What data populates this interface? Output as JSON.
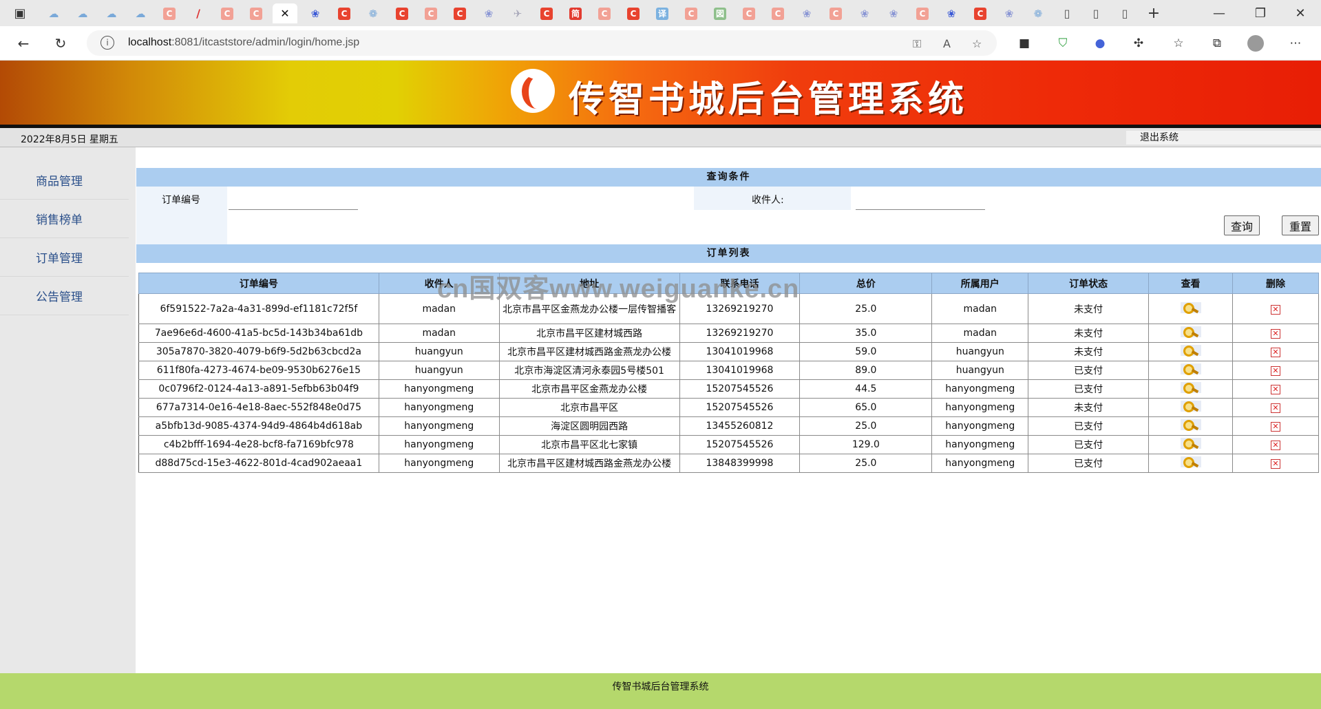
{
  "browser": {
    "url_host": "localhost",
    "url_path": ":8081/itcaststore/admin/login/home.jsp"
  },
  "banner": {
    "title": "传智书城后台管理系统"
  },
  "infobar": {
    "date": "2022年8月5日 星期五",
    "logout": "退出系统"
  },
  "sidebar": {
    "items": [
      {
        "label": "商品管理"
      },
      {
        "label": "销售榜单"
      },
      {
        "label": "订单管理"
      },
      {
        "label": "公告管理"
      }
    ]
  },
  "query": {
    "heading": "查询条件",
    "order_id_label": "订单编号",
    "receiver_label": "收件人:",
    "search_button": "查询",
    "reset_button": "重置"
  },
  "orders": {
    "heading": "订单列表",
    "columns": [
      "订单编号",
      "收件人",
      "地址",
      "联系电话",
      "总价",
      "所属用户",
      "订单状态",
      "查看",
      "删除"
    ],
    "rows": [
      {
        "id": "6f591522-7a2a-4a31-899d-ef1181c72f5f",
        "receiver": "madan",
        "address": "北京市昌平区金燕龙办公楼一层传智播客",
        "phone": "13269219270",
        "total": "25.0",
        "user": "madan",
        "status": "未支付"
      },
      {
        "id": "7ae96e6d-4600-41a5-bc5d-143b34ba61db",
        "receiver": "madan",
        "address": "北京市昌平区建材城西路",
        "phone": "13269219270",
        "total": "35.0",
        "user": "madan",
        "status": "未支付"
      },
      {
        "id": "305a7870-3820-4079-b6f9-5d2b63cbcd2a",
        "receiver": "huangyun",
        "address": "北京市昌平区建材城西路金燕龙办公楼",
        "phone": "13041019968",
        "total": "59.0",
        "user": "huangyun",
        "status": "未支付"
      },
      {
        "id": "611f80fa-4273-4674-be09-9530b6276e15",
        "receiver": "huangyun",
        "address": "北京市海淀区清河永泰园5号楼501",
        "phone": "13041019968",
        "total": "89.0",
        "user": "huangyun",
        "status": "已支付"
      },
      {
        "id": "0c0796f2-0124-4a13-a891-5efbb63b04f9",
        "receiver": "hanyongmeng",
        "address": "北京市昌平区金燕龙办公楼",
        "phone": "15207545526",
        "total": "44.5",
        "user": "hanyongmeng",
        "status": "已支付"
      },
      {
        "id": "677a7314-0e16-4e18-8aec-552f848e0d75",
        "receiver": "hanyongmeng",
        "address": "北京市昌平区",
        "phone": "15207545526",
        "total": "65.0",
        "user": "hanyongmeng",
        "status": "未支付"
      },
      {
        "id": "a5bfb13d-9085-4374-94d9-4864b4d618ab",
        "receiver": "hanyongmeng",
        "address": "海淀区圆明园西路",
        "phone": "13455260812",
        "total": "25.0",
        "user": "hanyongmeng",
        "status": "已支付"
      },
      {
        "id": "c4b2bfff-1694-4e28-bcf8-fa7169bfc978",
        "receiver": "hanyongmeng",
        "address": "北京市昌平区北七家镇",
        "phone": "15207545526",
        "total": "129.0",
        "user": "hanyongmeng",
        "status": "已支付"
      },
      {
        "id": "d88d75cd-15e3-4622-801d-4cad902aeaa1",
        "receiver": "hanyongmeng",
        "address": "北京市昌平区建材城西路金燕龙办公楼",
        "phone": "13848399998",
        "total": "25.0",
        "user": "hanyongmeng",
        "status": "已支付"
      }
    ]
  },
  "footer": {
    "text": "传智书城后台管理系统"
  },
  "watermark": "cn国双客www.weiguanke.cn"
}
